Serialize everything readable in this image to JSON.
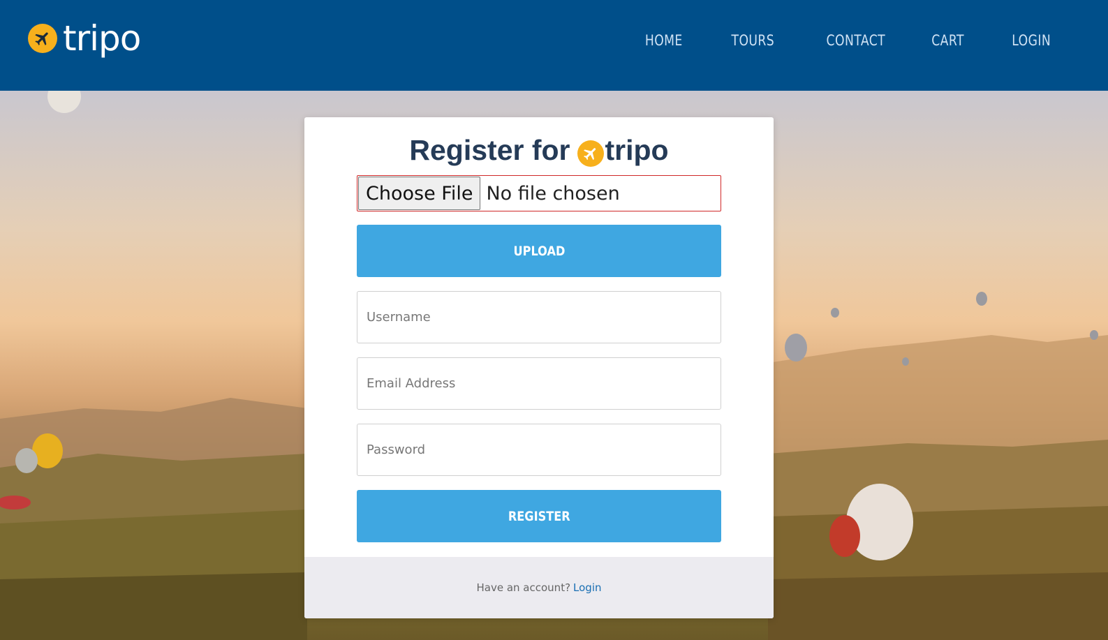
{
  "brand": {
    "name": "tripo",
    "icon": "airplane-icon",
    "badge_color": "#f7b01c"
  },
  "nav": {
    "items": [
      {
        "label": "HOME"
      },
      {
        "label": "TOURS"
      },
      {
        "label": "CONTACT"
      },
      {
        "label": "CART"
      },
      {
        "label": "LOGIN"
      }
    ]
  },
  "register": {
    "title_prefix": "Register for",
    "title_brand": "tripo",
    "file_button": "Choose File",
    "file_status": "No file chosen",
    "upload_label": "UPLOAD",
    "username_placeholder": "Username",
    "email_placeholder": "Email Address",
    "password_placeholder": "Password",
    "register_label": "REGISTER",
    "footer_text": "Have an account?",
    "footer_link": "Login"
  },
  "colors": {
    "navbar": "#004f8a",
    "button": "#3fa7e1",
    "accent": "#f7b01c",
    "link": "#1a6fb3",
    "file_border": "#d02828"
  }
}
